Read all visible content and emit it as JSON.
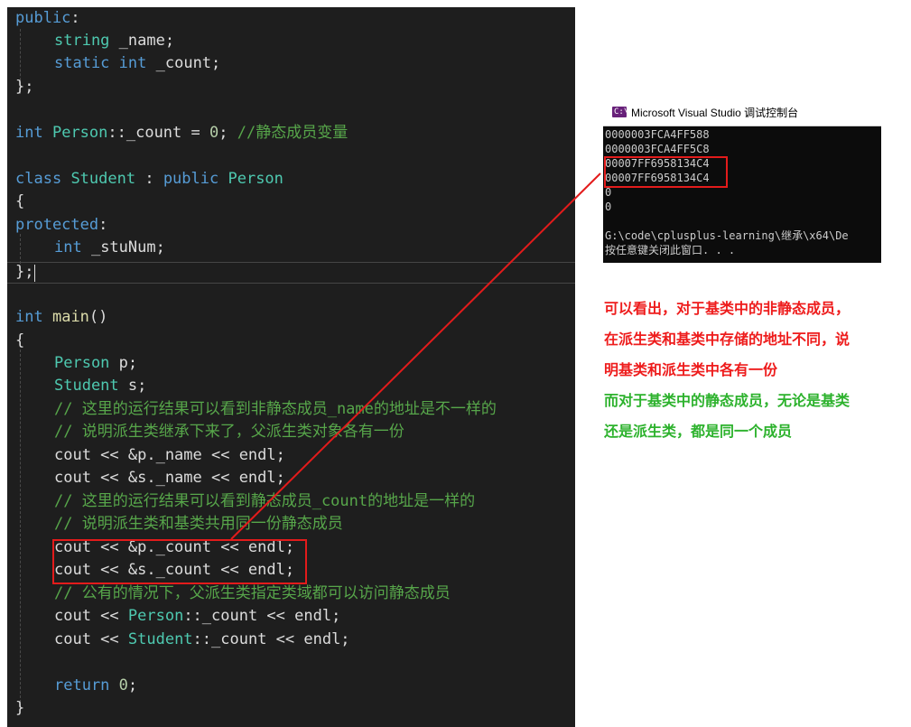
{
  "code": {
    "l1": {
      "kw": "public",
      "p": ":"
    },
    "l2": {
      "ty": "string",
      "rest": " _name;"
    },
    "l3": {
      "kw1": "static",
      "kw2": "int",
      "rest": " _count;"
    },
    "l4": {
      "p": "};"
    },
    "l6": {
      "kw": "int",
      "ty": "Person",
      "p1": "::_count = ",
      "num": "0",
      "p2": "; ",
      "cm": "//静态成员变量"
    },
    "l8": {
      "kw1": "class",
      "ty1": "Student",
      "p1": " : ",
      "kw2": "public",
      "ty2": "Person"
    },
    "l9": {
      "p": "{"
    },
    "l10": {
      "kw": "protected",
      "p": ":"
    },
    "l11": {
      "kw": "int",
      "rest": " _stuNum;"
    },
    "l12": {
      "p": "};"
    },
    "l14": {
      "kw": "int",
      "fn": "main",
      "p": "()"
    },
    "l15": {
      "p": "{"
    },
    "l16": {
      "ty": "Person",
      "rest": " p;"
    },
    "l17": {
      "ty": "Student",
      "rest": " s;"
    },
    "l18": {
      "cm": "// 这里的运行结果可以看到非静态成员_name的地址是不一样的"
    },
    "l19": {
      "cm": "// 说明派生类继承下来了，父派生类对象各有一份"
    },
    "l20": {
      "txt": "cout << &p._name << endl;"
    },
    "l21": {
      "txt": "cout << &s._name << endl;"
    },
    "l22": {
      "cm": "// 这里的运行结果可以看到静态成员_count的地址是一样的"
    },
    "l23": {
      "cm": "// 说明派生类和基类共用同一份静态成员"
    },
    "l24": {
      "txt": "cout << &p._count << endl;"
    },
    "l25": {
      "txt": "cout << &s._count << endl;"
    },
    "l26": {
      "cm": "// 公有的情况下，父派生类指定类域都可以访问静态成员"
    },
    "l27": {
      "p1": "cout << ",
      "ty": "Person",
      "p2": "::_count << endl;"
    },
    "l28": {
      "p1": "cout << ",
      "ty": "Student",
      "p2": "::_count << endl;"
    },
    "l30": {
      "kw": "return",
      "p": " ",
      "num": "0",
      "p2": ";"
    },
    "l31": {
      "p": "}"
    }
  },
  "console": {
    "icon_text": "C:\\",
    "title": "Microsoft Visual Studio 调试控制台",
    "lines": [
      "0000003FCA4FF588",
      "0000003FCA4FF5C8",
      "00007FF6958134C4",
      "00007FF6958134C4",
      "0",
      "0",
      "",
      "G:\\code\\cplusplus-learning\\继承\\x64\\De",
      "按任意键关闭此窗口. . ."
    ]
  },
  "notes": {
    "red": [
      "可以看出，对于基类中的非静态成员，",
      "在派生类和基类中存储的地址不同，说",
      "明基类和派生类中各有一份"
    ],
    "green": [
      "而对于基类中的静态成员，无论是基类",
      "还是派生类，都是同一个成员"
    ]
  },
  "colors": {
    "editor_bg": "#1e1e1e",
    "keyword": "#569cd6",
    "type": "#4ec9b0",
    "function": "#dcdcaa",
    "number": "#b5cea8",
    "comment": "#57a64a",
    "highlight": "#e31b1b",
    "note_red": "#ee1c1c",
    "note_green": "#2db22d"
  }
}
